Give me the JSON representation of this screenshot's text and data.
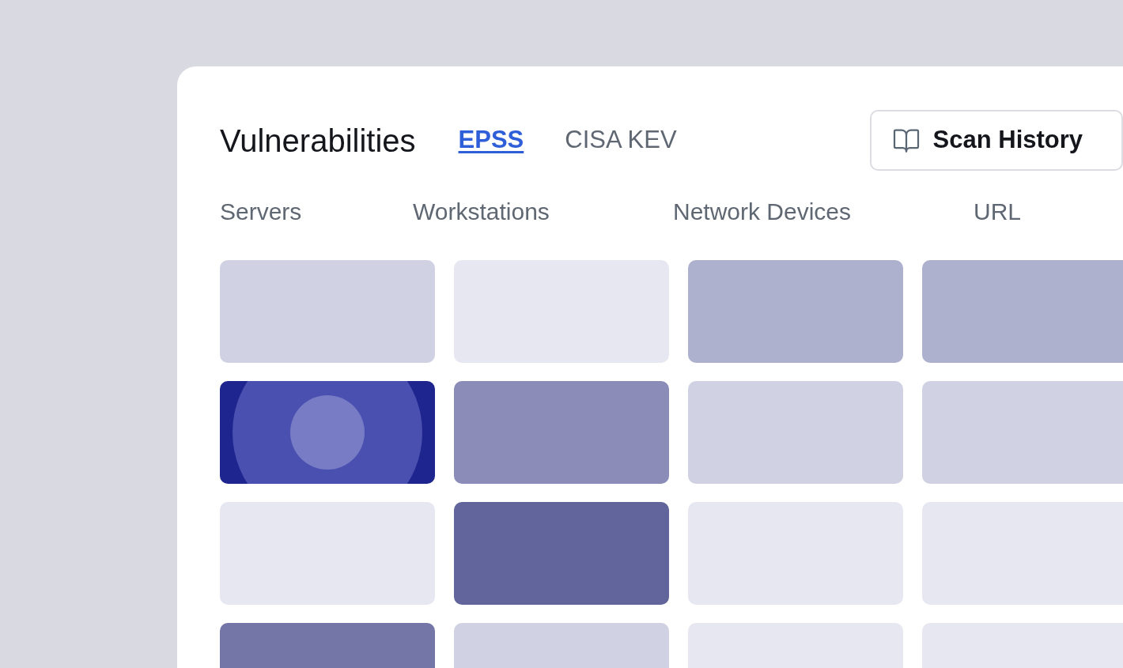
{
  "header": {
    "title": "Vulnerabilities",
    "tabs": [
      {
        "label": "EPSS",
        "selected": true
      },
      {
        "label": "CISA KEV",
        "selected": false
      }
    ],
    "button": "Scan History"
  },
  "columns": [
    "Servers",
    "Workstations",
    "Network Devices",
    "URL"
  ],
  "grid": {
    "rows": [
      {
        "cells": [
          {
            "color": "#d0d1e3",
            "selected": false
          },
          {
            "color": "#e7e7f1",
            "selected": false
          },
          {
            "color": "#aeb1ce",
            "selected": false
          },
          {
            "color": "#aeb1ce",
            "selected": false
          }
        ]
      },
      {
        "cells": [
          {
            "color": "#1e258f",
            "selected": true
          },
          {
            "color": "#8b8cb8",
            "selected": false
          },
          {
            "color": "#d0d1e3",
            "selected": false
          },
          {
            "color": "#d0d1e3",
            "selected": false
          }
        ]
      },
      {
        "cells": [
          {
            "color": "#e7e7f1",
            "selected": false
          },
          {
            "color": "#62659c",
            "selected": false
          },
          {
            "color": "#e7e7f1",
            "selected": false
          },
          {
            "color": "#e7e7f1",
            "selected": false
          }
        ]
      },
      {
        "cells": [
          {
            "color": "#7476a8",
            "selected": false
          },
          {
            "color": "#d0d1e3",
            "selected": false
          },
          {
            "color": "#e7e7f1",
            "selected": false
          },
          {
            "color": "#e7e7f1",
            "selected": false
          }
        ]
      }
    ]
  }
}
